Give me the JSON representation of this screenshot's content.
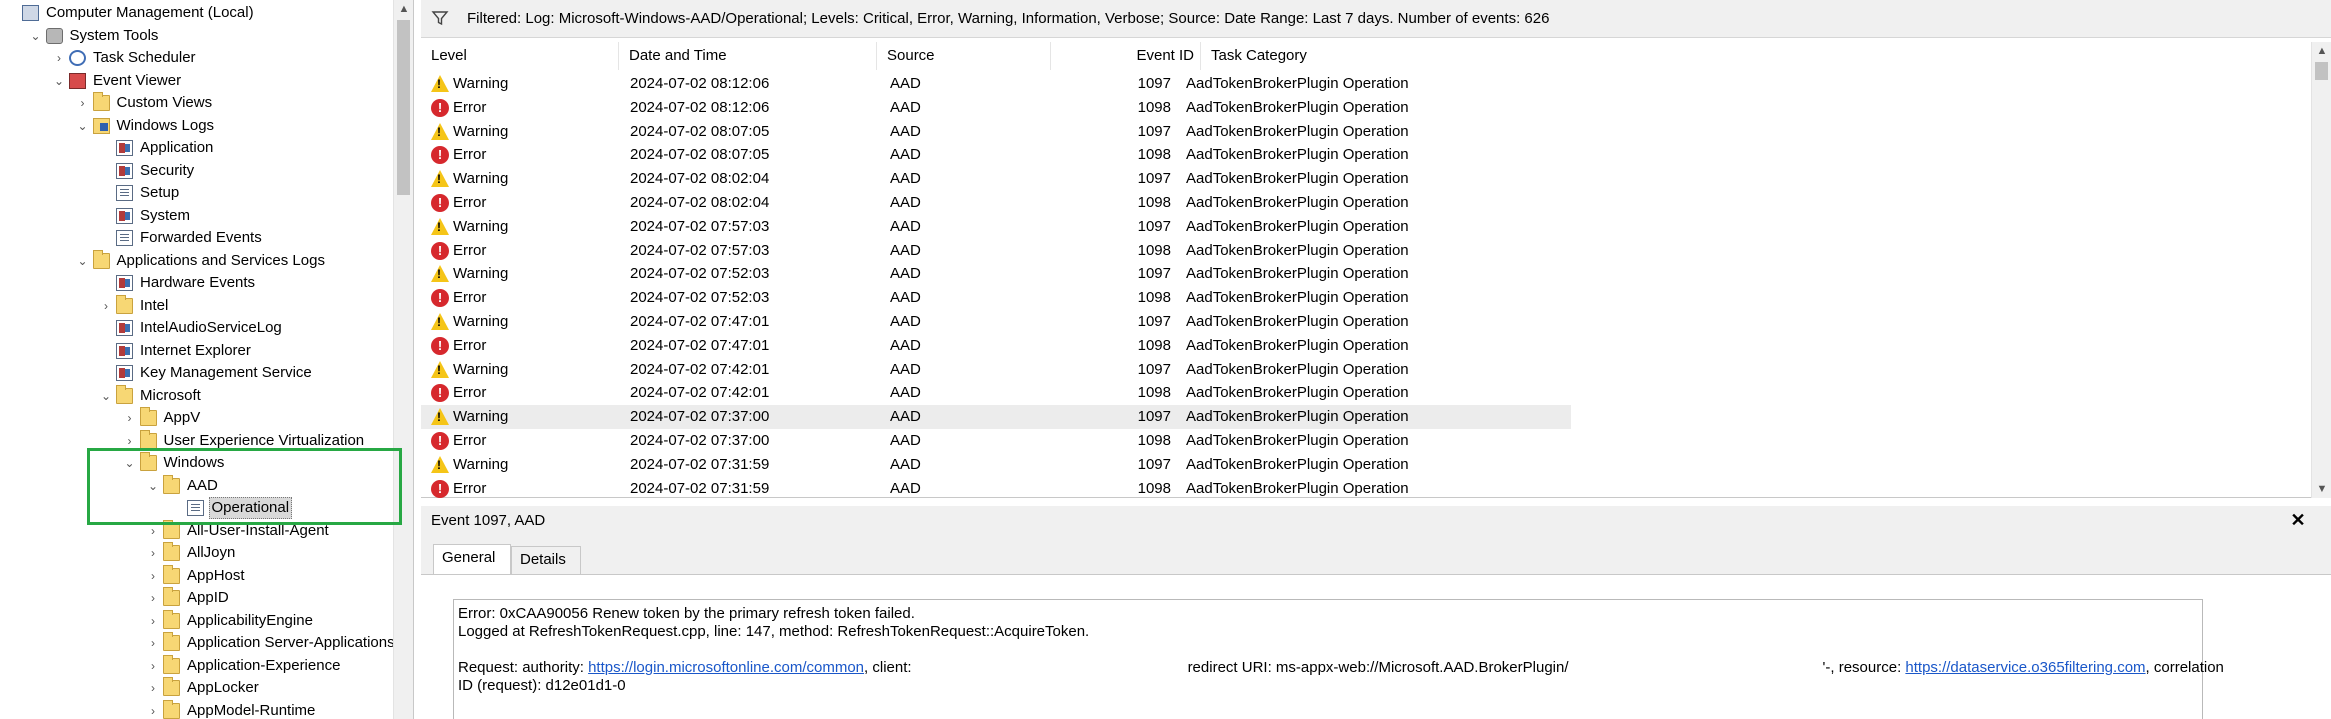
{
  "tree": {
    "items": [
      {
        "label": "Computer Management (Local)",
        "icon": "computer-icon",
        "depth": 0,
        "chevron": ""
      },
      {
        "label": "System Tools",
        "icon": "tools-icon",
        "depth": 1,
        "chevron": "expanded"
      },
      {
        "label": "Task Scheduler",
        "icon": "clock-icon",
        "depth": 2,
        "chevron": "collapsed"
      },
      {
        "label": "Event Viewer",
        "icon": "event-viewer-icon",
        "depth": 2,
        "chevron": "expanded"
      },
      {
        "label": "Custom Views",
        "icon": "folder-icon",
        "depth": 3,
        "chevron": "collapsed"
      },
      {
        "label": "Windows Logs",
        "icon": "windows-logs-icon",
        "depth": 3,
        "chevron": "expanded"
      },
      {
        "label": "Application",
        "icon": "log-icon",
        "depth": 4,
        "chevron": ""
      },
      {
        "label": "Security",
        "icon": "log-icon",
        "depth": 4,
        "chevron": ""
      },
      {
        "label": "Setup",
        "icon": "plain-log-icon",
        "depth": 4,
        "chevron": ""
      },
      {
        "label": "System",
        "icon": "log-icon",
        "depth": 4,
        "chevron": ""
      },
      {
        "label": "Forwarded Events",
        "icon": "plain-log-icon",
        "depth": 4,
        "chevron": ""
      },
      {
        "label": "Applications and Services Logs",
        "icon": "folder-icon",
        "depth": 3,
        "chevron": "expanded"
      },
      {
        "label": "Hardware Events",
        "icon": "log-icon",
        "depth": 4,
        "chevron": ""
      },
      {
        "label": "Intel",
        "icon": "folder-icon",
        "depth": 4,
        "chevron": "collapsed"
      },
      {
        "label": "IntelAudioServiceLog",
        "icon": "log-icon",
        "depth": 4,
        "chevron": ""
      },
      {
        "label": "Internet Explorer",
        "icon": "log-icon",
        "depth": 4,
        "chevron": ""
      },
      {
        "label": "Key Management Service",
        "icon": "log-icon",
        "depth": 4,
        "chevron": ""
      },
      {
        "label": "Microsoft",
        "icon": "folder-icon",
        "depth": 4,
        "chevron": "expanded"
      },
      {
        "label": "AppV",
        "icon": "folder-icon",
        "depth": 5,
        "chevron": "collapsed"
      },
      {
        "label": "User Experience Virtualization",
        "icon": "folder-icon",
        "depth": 5,
        "chevron": "collapsed"
      },
      {
        "label": "Windows",
        "icon": "folder-icon",
        "depth": 5,
        "chevron": "expanded"
      },
      {
        "label": "AAD",
        "icon": "folder-icon",
        "depth": 6,
        "chevron": "expanded"
      },
      {
        "label": "Operational",
        "icon": "plain-log-icon",
        "depth": 7,
        "chevron": "",
        "selected": true
      },
      {
        "label": "All-User-Install-Agent",
        "icon": "folder-icon",
        "depth": 6,
        "chevron": "collapsed"
      },
      {
        "label": "AllJoyn",
        "icon": "folder-icon",
        "depth": 6,
        "chevron": "collapsed"
      },
      {
        "label": "AppHost",
        "icon": "folder-icon",
        "depth": 6,
        "chevron": "collapsed"
      },
      {
        "label": "AppID",
        "icon": "folder-icon",
        "depth": 6,
        "chevron": "collapsed"
      },
      {
        "label": "ApplicabilityEngine",
        "icon": "folder-icon",
        "depth": 6,
        "chevron": "collapsed"
      },
      {
        "label": "Application Server-Applications",
        "icon": "folder-icon",
        "depth": 6,
        "chevron": "collapsed"
      },
      {
        "label": "Application-Experience",
        "icon": "folder-icon",
        "depth": 6,
        "chevron": "collapsed"
      },
      {
        "label": "AppLocker",
        "icon": "folder-icon",
        "depth": 6,
        "chevron": "collapsed"
      },
      {
        "label": "AppModel-Runtime",
        "icon": "folder-icon",
        "depth": 6,
        "chevron": "collapsed"
      }
    ]
  },
  "filter": {
    "text": "Filtered: Log: Microsoft-Windows-AAD/Operational; Levels: Critical, Error, Warning, Information, Verbose; Source: Date Range: Last 7 days. Number of events: 626",
    "icon": "funnel-icon"
  },
  "events": {
    "columns": [
      "Level",
      "Date and Time",
      "Source",
      "Event ID",
      "Task Category"
    ],
    "rows": [
      {
        "level": "Warning",
        "datetime": "2024-07-02 08:12:06",
        "source": "AAD",
        "event_id": "1097",
        "category": "AadTokenBrokerPlugin Operation"
      },
      {
        "level": "Error",
        "datetime": "2024-07-02 08:12:06",
        "source": "AAD",
        "event_id": "1098",
        "category": "AadTokenBrokerPlugin Operation"
      },
      {
        "level": "Warning",
        "datetime": "2024-07-02 08:07:05",
        "source": "AAD",
        "event_id": "1097",
        "category": "AadTokenBrokerPlugin Operation"
      },
      {
        "level": "Error",
        "datetime": "2024-07-02 08:07:05",
        "source": "AAD",
        "event_id": "1098",
        "category": "AadTokenBrokerPlugin Operation"
      },
      {
        "level": "Warning",
        "datetime": "2024-07-02 08:02:04",
        "source": "AAD",
        "event_id": "1097",
        "category": "AadTokenBrokerPlugin Operation"
      },
      {
        "level": "Error",
        "datetime": "2024-07-02 08:02:04",
        "source": "AAD",
        "event_id": "1098",
        "category": "AadTokenBrokerPlugin Operation"
      },
      {
        "level": "Warning",
        "datetime": "2024-07-02 07:57:03",
        "source": "AAD",
        "event_id": "1097",
        "category": "AadTokenBrokerPlugin Operation"
      },
      {
        "level": "Error",
        "datetime": "2024-07-02 07:57:03",
        "source": "AAD",
        "event_id": "1098",
        "category": "AadTokenBrokerPlugin Operation"
      },
      {
        "level": "Warning",
        "datetime": "2024-07-02 07:52:03",
        "source": "AAD",
        "event_id": "1097",
        "category": "AadTokenBrokerPlugin Operation"
      },
      {
        "level": "Error",
        "datetime": "2024-07-02 07:52:03",
        "source": "AAD",
        "event_id": "1098",
        "category": "AadTokenBrokerPlugin Operation"
      },
      {
        "level": "Warning",
        "datetime": "2024-07-02 07:47:01",
        "source": "AAD",
        "event_id": "1097",
        "category": "AadTokenBrokerPlugin Operation"
      },
      {
        "level": "Error",
        "datetime": "2024-07-02 07:47:01",
        "source": "AAD",
        "event_id": "1098",
        "category": "AadTokenBrokerPlugin Operation"
      },
      {
        "level": "Warning",
        "datetime": "2024-07-02 07:42:01",
        "source": "AAD",
        "event_id": "1097",
        "category": "AadTokenBrokerPlugin Operation"
      },
      {
        "level": "Error",
        "datetime": "2024-07-02 07:42:01",
        "source": "AAD",
        "event_id": "1098",
        "category": "AadTokenBrokerPlugin Operation"
      },
      {
        "level": "Warning",
        "datetime": "2024-07-02 07:37:00",
        "source": "AAD",
        "event_id": "1097",
        "category": "AadTokenBrokerPlugin Operation",
        "selected": true
      },
      {
        "level": "Error",
        "datetime": "2024-07-02 07:37:00",
        "source": "AAD",
        "event_id": "1098",
        "category": "AadTokenBrokerPlugin Operation"
      },
      {
        "level": "Warning",
        "datetime": "2024-07-02 07:31:59",
        "source": "AAD",
        "event_id": "1097",
        "category": "AadTokenBrokerPlugin Operation"
      },
      {
        "level": "Error",
        "datetime": "2024-07-02 07:31:59",
        "source": "AAD",
        "event_id": "1098",
        "category": "AadTokenBrokerPlugin Operation"
      }
    ]
  },
  "detail": {
    "title": "Event 1097, AAD",
    "close_label": "✕",
    "tabs": [
      "General",
      "Details"
    ],
    "line1": "Error: 0xCAA90056 Renew token by the primary refresh token failed.",
    "line2": "Logged at RefreshTokenRequest.cpp, line: 147, method: RefreshTokenRequest::AcquireToken.",
    "req_prefix": "Request: authority: ",
    "req_authority": "https://login.microsoftonline.com/common",
    "req_client": ", client:",
    "req_redirect": "redirect URI: ms-appx-web://Microsoft.AAD.BrokerPlugin/",
    "req_fragment": "'-",
    "req_resource_label": ", resource: ",
    "req_resource": "https://dataservice.o365filtering.com",
    "req_correlation": ", correlation",
    "req_line2": "ID (request): d12e01d1-0"
  },
  "colors": {
    "highlight": "#27a844",
    "link": "#1a57c9",
    "warning": "#f5c518",
    "error": "#d6282d"
  }
}
